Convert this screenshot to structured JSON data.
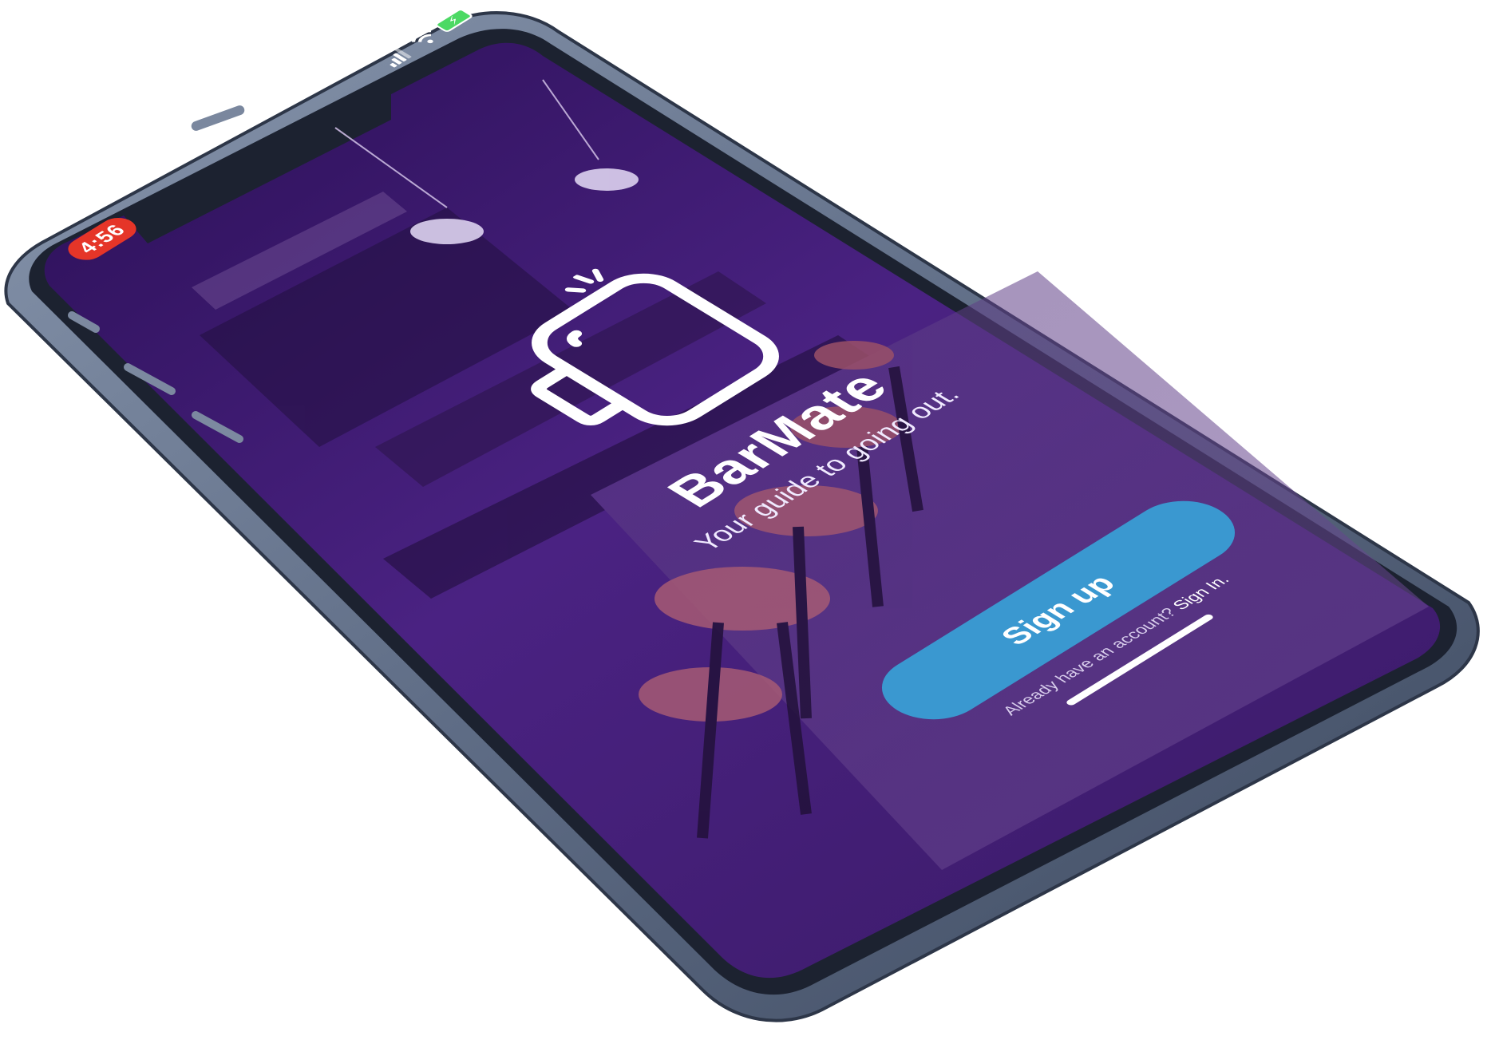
{
  "status_bar": {
    "time": "4:56",
    "time_badge_color": "#e53528",
    "battery_color": "#4cd964",
    "icons": [
      "cellular-signal-icon",
      "wifi-icon",
      "battery-charging-icon"
    ]
  },
  "background": {
    "overlay_color": "#3d1a6e",
    "scene": "bar interior"
  },
  "brand": {
    "logo_icon": "beer-mug-icon",
    "name": "BarMate",
    "tagline": "Your guide to going out."
  },
  "actions": {
    "signup_label": "Sign up",
    "signup_color": "#3a98d0",
    "signin_prompt": "Already have an account?",
    "signin_link": "Sign In."
  }
}
